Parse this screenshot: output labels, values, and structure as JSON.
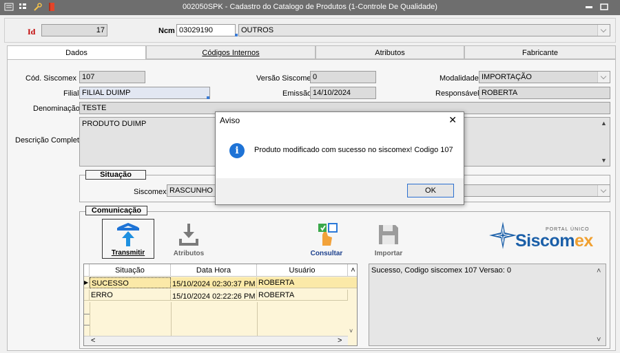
{
  "window": {
    "title": "002050SPK - Cadastro do Catalogo de Produtos (1-Controle De Qualidade)",
    "minimize_glyph": "▭",
    "maximize_glyph": "▣"
  },
  "header": {
    "id_label": "Id",
    "id_value": "17",
    "ncm_label": "Ncm",
    "ncm_code": "03029190",
    "ncm_desc": "OUTROS"
  },
  "tabs": [
    {
      "label": "Dados",
      "active": true
    },
    {
      "label": "Códigos Internos",
      "active": false
    },
    {
      "label": "Atributos",
      "active": false
    },
    {
      "label": "Fabricante",
      "active": false
    }
  ],
  "dados": {
    "cod_siscomex_label": "Cód. Siscomex",
    "cod_siscomex_value": "107",
    "versao_label": "Versão Siscomex",
    "versao_value": "0",
    "modalidade_label": "Modalidade",
    "modalidade_value": "IMPORTAÇÃO",
    "filial_label": "Filial",
    "filial_value": "FILIAL DUIMP",
    "emissao_label": "Emissão",
    "emissao_value": "14/10/2024",
    "responsavel_label": "Responsável",
    "responsavel_value": "ROBERTA",
    "denominacao_label": "Denominação",
    "denominacao_value": "TESTE",
    "descricao_label": "Descrição Completa",
    "descricao_value": "PRODUTO DUIMP"
  },
  "situacao": {
    "group_label": "Situação",
    "siscomex_label": "Siscomex",
    "siscomex_value": "RASCUNHO"
  },
  "comunicacao": {
    "group_label": "Comunicação",
    "buttons": {
      "transmitir": "Transmitir",
      "atributos": "Atributos",
      "consultar": "Consultar",
      "importar": "Importar"
    },
    "logo_top": "PORTAL ÚNICO",
    "logo_main": "Siscom",
    "logo_suffix": "ex",
    "grid_columns": [
      "Situação",
      "Data Hora",
      "Usuário"
    ],
    "grid_rows": [
      {
        "situacao": "SUCESSO",
        "data_hora": "15/10/2024 02:30:37 PM",
        "usuario": "ROBERTA",
        "selected": true
      },
      {
        "situacao": "ERRO",
        "data_hora": "15/10/2024 02:22:26 PM",
        "usuario": "ROBERTA",
        "selected": false
      }
    ],
    "log_text": "Sucesso, Codigo siscomex 107 Versao: 0"
  },
  "dialog": {
    "title": "Aviso",
    "message": "Produto modificado com sucesso no siscomex! Codigo 107",
    "ok_label": "OK",
    "close_glyph": "✕",
    "info_glyph": "i"
  },
  "colors": {
    "titlebar": "#6e6e6e",
    "id_label": "#c00000",
    "accent_blue": "#1e73d6",
    "siscomex_blue": "#1b5fa8",
    "siscomex_orange": "#f0a030"
  }
}
